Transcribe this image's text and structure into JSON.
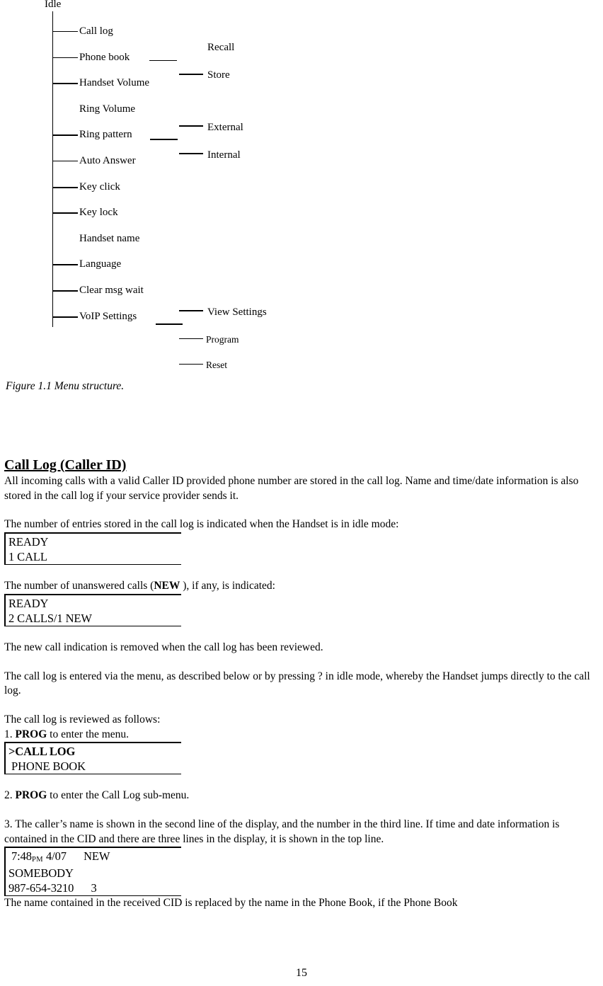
{
  "figure": {
    "root_label": "Idle",
    "caption": "Figure 1.1 Menu structure.",
    "items": [
      {
        "label": "Call log",
        "has_connector": true,
        "connector_weight": "thin"
      },
      {
        "label": "Phone book",
        "has_connector": true,
        "connector_weight": "thin"
      },
      {
        "label": "Handset Volume",
        "has_connector": true,
        "connector_weight": "thick"
      },
      {
        "label": "Ring Volume",
        "has_connector": false,
        "connector_weight": "none"
      },
      {
        "label": "Ring pattern",
        "has_connector": true,
        "connector_weight": "thick"
      },
      {
        "label": "Auto Answer",
        "has_connector": true,
        "connector_weight": "thin"
      },
      {
        "label": "Key click",
        "has_connector": true,
        "connector_weight": "thick"
      },
      {
        "label": "Key lock",
        "has_connector": true,
        "connector_weight": "thick"
      },
      {
        "label": "Handset name",
        "has_connector": false,
        "connector_weight": "none"
      },
      {
        "label": "Language",
        "has_connector": true,
        "connector_weight": "thick"
      },
      {
        "label": "Clear msg wait",
        "has_connector": true,
        "connector_weight": "thick"
      },
      {
        "label": "VoIP Settings",
        "has_connector": true,
        "connector_weight": "thick"
      }
    ],
    "subitems": [
      {
        "label": "Recall",
        "parent": "Phone book",
        "has_connector": false
      },
      {
        "label": "Store",
        "parent": "Phone book",
        "has_connector": true
      },
      {
        "label": "External",
        "parent": "Ring pattern",
        "has_connector": true
      },
      {
        "label": "Internal",
        "parent": "Ring pattern",
        "has_connector": true
      },
      {
        "label": "View Settings",
        "parent": "VoIP Settings",
        "has_connector": true
      },
      {
        "label": "Program",
        "parent": "VoIP Settings",
        "has_connector": true
      },
      {
        "label": "Reset",
        "parent": "VoIP Settings",
        "has_connector": true
      }
    ]
  },
  "article": {
    "heading": "Call Log (Caller ID)",
    "intro": "All incoming calls with a valid Caller ID provided phone number are stored in the call log. Name and time/date information is also stored in the call log if your service provider sends it.",
    "entries_lead": "The number of entries stored in the call log is indicated when the Handset is in idle mode:",
    "display_entries": {
      "line1": "READY",
      "line2": "1 CALL"
    },
    "unanswered_lead_a": "The number of unanswered calls (",
    "unanswered_lead_bold": "NEW",
    "unanswered_lead_b": " ), if any, is indicated:",
    "display_unanswered": {
      "line1": "READY",
      "line2": "2 CALLS/1 NEW"
    },
    "removed_note": "The new call indication is removed when the call log has been reviewed.",
    "entered_via_menu": "The call log is entered via the menu, as described below or by pressing ?   in idle mode, whereby the Handset jumps directly to the call log.",
    "reviewed_lead": "The call log is reviewed as follows:",
    "step1_num": "1. ",
    "step1_bold": "PROG",
    "step1_rest": " to enter the menu.",
    "display_menu": {
      "line1": ">CALL LOG",
      "line2": " PHONE BOOK"
    },
    "step2_num": "2. ",
    "step2_bold": "PROG",
    "step2_rest": " to enter the Call Log sub-menu.",
    "step3": "3. The caller’s name is shown in the second line of the display, and the number in the third line. If time and date information is contained in the CID and there are three lines in the display, it is shown in the top line.",
    "display_cid": {
      "time": " 7:48",
      "ampm": "PM",
      "date": " 4/07",
      "gap": "      ",
      "flag": "NEW",
      "line2": "SOMEBODY",
      "line3_number": "987-654-3210",
      "line3_gap": "      ",
      "line3_index": "3"
    },
    "closing": "The name contained in the received CID is replaced by the name in the Phone Book, if the Phone Book"
  },
  "footer": {
    "page_number": "15"
  }
}
